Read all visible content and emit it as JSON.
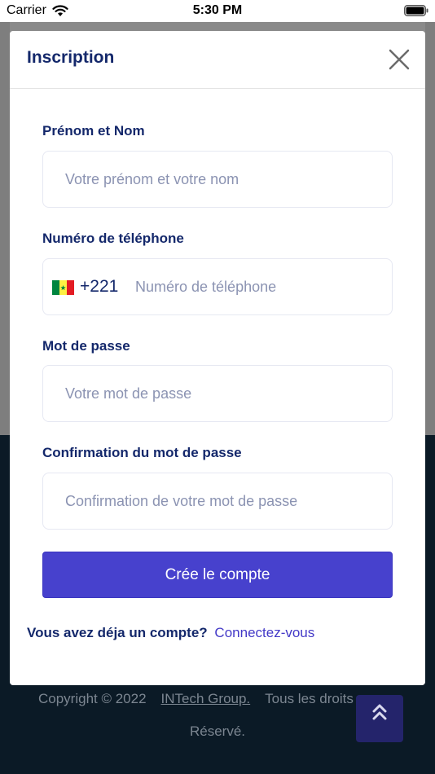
{
  "status_bar": {
    "carrier": "Carrier",
    "time": "5:30 PM"
  },
  "modal": {
    "title": "Inscription",
    "fields": {
      "name": {
        "label": "Prénom et Nom",
        "placeholder": "Votre prénom et votre nom"
      },
      "phone": {
        "label": "Numéro de téléphone",
        "dial_code": "+221",
        "country": "Senegal",
        "placeholder": "Numéro de téléphone"
      },
      "password": {
        "label": "Mot de passe",
        "placeholder": "Votre mot de passe"
      },
      "confirm_password": {
        "label": "Confirmation du mot de passe",
        "placeholder": "Confirmation de votre mot de passe"
      }
    },
    "submit_label": "Crée le compte",
    "login_question": "Vous avez déja un compte?",
    "login_link": "Connectez-vous"
  },
  "footer": {
    "copyright": "Copyright © 2022",
    "company": "INTech Group.",
    "rights_tail": "Tous les droits",
    "reserved": "Réservé."
  },
  "colors": {
    "primary": "#4741cd",
    "heading": "#14286b",
    "placeholder": "#8b93b2",
    "footer_bg": "#0b1a26",
    "flag_green": "#00853f",
    "flag_yellow": "#fdef42",
    "flag_red": "#e31b23"
  },
  "icons": [
    "wifi-icon",
    "battery-icon",
    "close-icon",
    "senegal-flag-icon",
    "double-chevron-up-icon"
  ]
}
